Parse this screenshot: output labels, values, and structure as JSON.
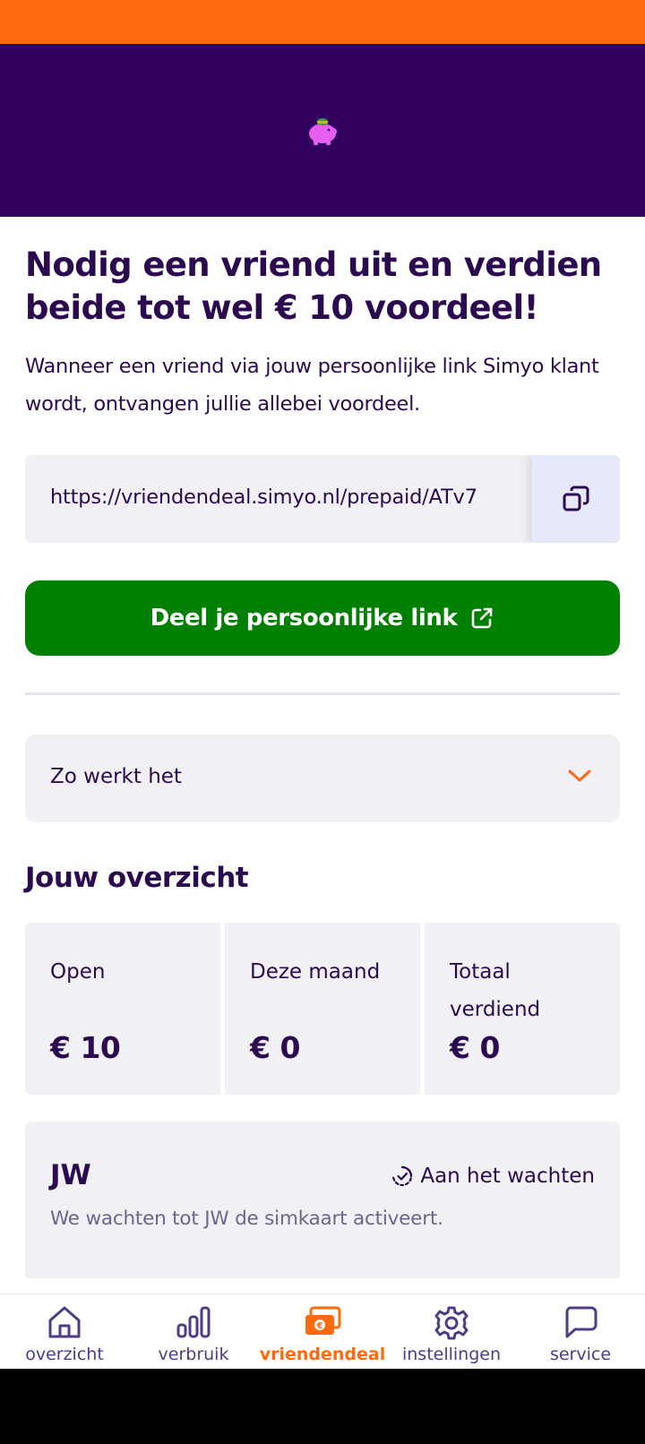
{
  "hero": {
    "icon": "piggy-bank-icon"
  },
  "headline": "Nodig een vriend uit en verdien beide tot wel € 10 voordeel!",
  "intro": "Wanneer een vriend via jouw persoonlijke link Simyo klant wordt, ontvangen jullie allebei voordeel.",
  "referral_link": "https://vriendendeal.simyo.nl/prepaid/ATv7",
  "share_button": "Deel je persoonlijke link",
  "accordion": {
    "label": "Zo werkt het"
  },
  "overview": {
    "title": "Jouw overzicht",
    "stats": [
      {
        "label": "Open",
        "value": "€ 10"
      },
      {
        "label": "Deze maand",
        "value": "€ 0"
      },
      {
        "label": "Totaal verdiend",
        "value": "€ 0"
      }
    ]
  },
  "friend": {
    "name": "JW",
    "status": "Aan het wachten",
    "description": "We wachten tot JW de simkaart activeert."
  },
  "nav": {
    "items": [
      {
        "label": "overzicht",
        "icon": "home-icon"
      },
      {
        "label": "verbruik",
        "icon": "bar-chart-icon"
      },
      {
        "label": "vriendendeal",
        "icon": "money-icon",
        "active": true
      },
      {
        "label": "instellingen",
        "icon": "gear-icon"
      },
      {
        "label": "service",
        "icon": "chat-icon"
      }
    ]
  },
  "colors": {
    "accent": "#ff6a10",
    "primary": "#32005e",
    "success": "#008000",
    "text": "#2b0a4f"
  }
}
